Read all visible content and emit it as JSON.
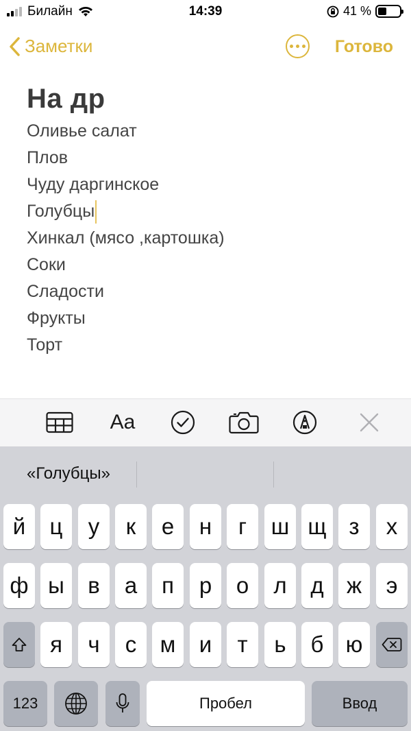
{
  "status_bar": {
    "carrier": "Билайн",
    "time": "14:39",
    "battery": "41 %",
    "battery_level": 0.41
  },
  "nav": {
    "back_label": "Заметки",
    "done_label": "Готово"
  },
  "note": {
    "title": "На др",
    "lines": [
      "Оливье салат",
      "Плов",
      "Чуду даргинское",
      "Голубцы",
      "Хинкал (мясо ,картошка)",
      "Соки",
      "Сладости",
      "Фрукты",
      "Торт"
    ]
  },
  "toolbar": {
    "format_label": "Aa",
    "icons": [
      "table-icon",
      "format-icon",
      "checklist-icon",
      "camera-icon",
      "markup-icon",
      "close-icon"
    ]
  },
  "keyboard": {
    "suggestion": "«Голубцы»",
    "row1": [
      "й",
      "ц",
      "у",
      "к",
      "е",
      "н",
      "г",
      "ш",
      "щ",
      "з",
      "х"
    ],
    "row2": [
      "ф",
      "ы",
      "в",
      "а",
      "п",
      "р",
      "о",
      "л",
      "д",
      "ж",
      "э"
    ],
    "row3": [
      "я",
      "ч",
      "с",
      "м",
      "и",
      "т",
      "ь",
      "б",
      "ю"
    ],
    "numbers_label": "123",
    "space_label": "Пробел",
    "return_label": "Ввод"
  },
  "colors": {
    "accent": "#dcb63c",
    "keyboard_bg": "#d2d3d8",
    "toolbar_bg": "#f5f5f6"
  }
}
